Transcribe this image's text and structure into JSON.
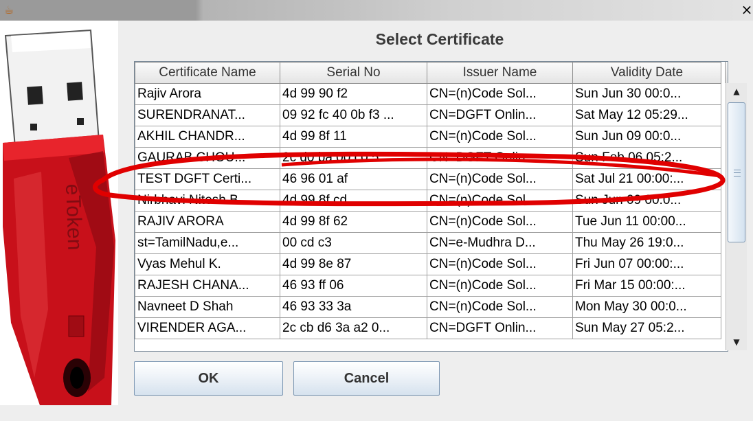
{
  "window": {
    "close_glyph": "×"
  },
  "icons": {
    "app": "java-icon",
    "close": "close-icon",
    "scroll_up": "arrow-up-icon",
    "scroll_down": "arrow-down-icon"
  },
  "dialog": {
    "title": "Select Certificate",
    "ok_label": "OK",
    "cancel_label": "Cancel"
  },
  "table": {
    "columns": [
      "Certificate Name",
      "Serial No",
      "Issuer Name",
      "Validity Date"
    ],
    "rows": [
      [
        "Rajiv Arora",
        "4d 99 90 f2",
        "CN=(n)Code Sol...",
        "Sun Jun 30 00:0..."
      ],
      [
        "SURENDRANAT...",
        "09 92 fc 40 0b f3 ...",
        "CN=DGFT Onlin...",
        "Sat May 12 05:29..."
      ],
      [
        "AKHIL CHANDR...",
        "4d 99 8f 11",
        "CN=(n)Code Sol...",
        "Sun Jun 09 00:0..."
      ],
      [
        "GAURAB CHOU...",
        "2c d0 ba 00 c0 5...",
        "CN=DGFT Onlin...",
        "Sun Feb 06 05:2..."
      ],
      [
        "TEST DGFT Certi...",
        "46 96 01 af",
        "CN=(n)Code Sol...",
        "Sat Jul 21 00:00:..."
      ],
      [
        "Nirbhavi Nitesh B...",
        "4d 99 8f cd",
        "CN=(n)Code Sol...",
        "Sun Jun 09 00:0..."
      ],
      [
        "RAJIV ARORA",
        "4d 99 8f 62",
        "CN=(n)Code Sol...",
        "Tue Jun 11 00:00..."
      ],
      [
        "st=TamilNadu,e...",
        "00 cd c3",
        "CN=e-Mudhra D...",
        "Thu May 26 19:0..."
      ],
      [
        "Vyas Mehul K.",
        "4d 99 8e 87",
        "CN=(n)Code Sol...",
        "Fri Jun 07 00:00:..."
      ],
      [
        "RAJESH CHANA...",
        "46 93 ff 06",
        "CN=(n)Code Sol...",
        "Fri Mar 15 00:00:..."
      ],
      [
        "Navneet D Shah",
        "46 93 33 3a",
        "CN=(n)Code Sol...",
        "Mon May 30 00:0..."
      ],
      [
        "VIRENDER AGA...",
        "2c cb d6 3a a2 0...",
        "CN=DGFT Onlin...",
        "Sun May 27 05:2..."
      ]
    ],
    "highlighted_row_index": 4
  },
  "token_image": {
    "brand_text": "eToken"
  },
  "colors": {
    "annotation": "#e00000",
    "token_body": "#c8101a"
  }
}
